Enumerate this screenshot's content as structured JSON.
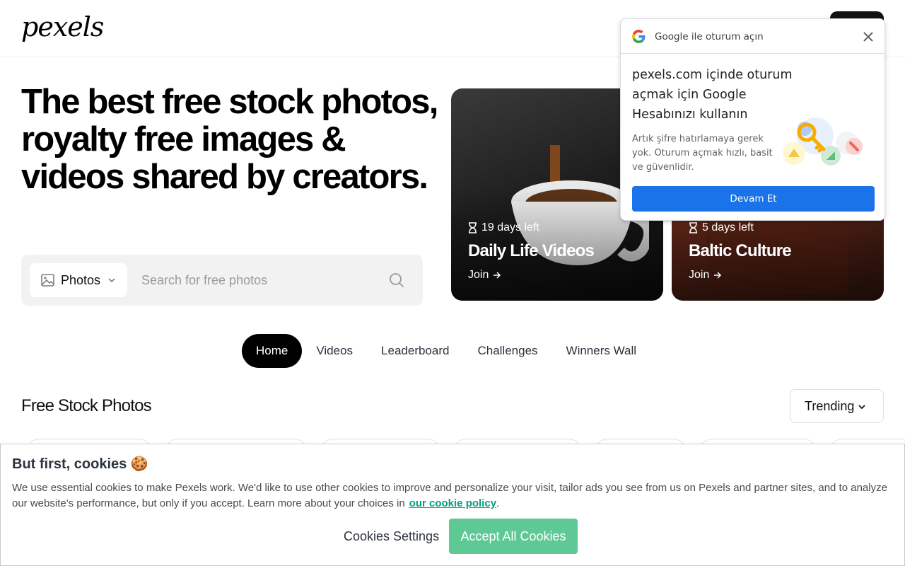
{
  "header": {
    "logo": "pexels"
  },
  "hero": {
    "title": "The best free stock photos, royalty free images & videos shared by creators."
  },
  "search": {
    "type_label": "Photos",
    "placeholder": "Search for free photos"
  },
  "challenges": [
    {
      "days_left": "19 days left",
      "title": "Daily Life Videos",
      "join": "Join"
    },
    {
      "days_left": "5 days left",
      "title": "Baltic Culture",
      "join": "Join"
    }
  ],
  "tabs": [
    {
      "label": "Home",
      "active": true
    },
    {
      "label": "Videos",
      "active": false
    },
    {
      "label": "Leaderboard",
      "active": false
    },
    {
      "label": "Challenges",
      "active": false
    },
    {
      "label": "Winners Wall",
      "active": false
    }
  ],
  "section": {
    "title": "Free Stock Photos",
    "sort_label": "Trending"
  },
  "google_popup": {
    "header": "Google ile oturum açın",
    "title": "pexels.com içinde oturum açmak için Google Hesabınızı kullanın",
    "description": "Artık şifre hatırlamaya gerek yok. Oturum açmak hızlı, basit ve güvenlidir.",
    "button": "Devam Et"
  },
  "cookie_banner": {
    "title": "But first, cookies 🍪",
    "text": "We use essential cookies to make Pexels work. We'd like to use other cookies to improve and personalize your visit, tailor ads you see from us on Pexels and partner sites, and to analyze our website's performance, but only if you accept. Learn more about your choices in",
    "link": "our cookie policy",
    "link_suffix": ".",
    "settings_button": "Cookies Settings",
    "accept_button": "Accept All Cookies"
  },
  "colors": {
    "accept_green": "#5ec994",
    "link_teal": "#05a081",
    "google_blue": "#1a73e8",
    "tab_active_bg": "#000000"
  },
  "icons": [
    "image-icon",
    "chevron-down-icon",
    "search-icon",
    "hourglass-icon",
    "arrow-right-icon",
    "google-logo-icon",
    "close-icon",
    "key-illustration"
  ]
}
